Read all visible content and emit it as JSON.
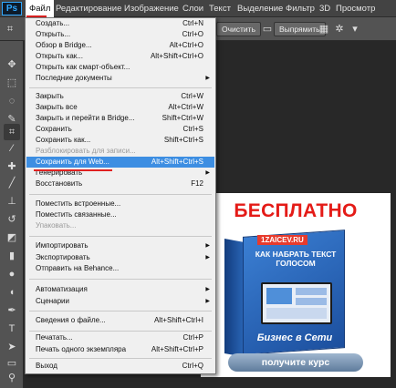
{
  "menubar": {
    "logo": "Ps",
    "items": [
      "Файл",
      "Редактирование",
      "Изображение",
      "Слои",
      "Текст",
      "Выделение",
      "Фильтр",
      "3D",
      "Просмотр"
    ]
  },
  "options": {
    "clear": "Очистить",
    "straighten": "Выпрямить"
  },
  "file_menu": [
    {
      "label": "Создать...",
      "shortcut": "Ctrl+N"
    },
    {
      "label": "Открыть...",
      "shortcut": "Ctrl+O"
    },
    {
      "label": "Обзор в Bridge...",
      "shortcut": "Alt+Ctrl+O"
    },
    {
      "label": "Открыть как...",
      "shortcut": "Alt+Shift+Ctrl+O"
    },
    {
      "label": "Открыть как смарт-объект...",
      "shortcut": ""
    },
    {
      "label": "Последние документы",
      "shortcut": "",
      "submenu": true
    },
    {
      "label": "Закрыть",
      "shortcut": "Ctrl+W"
    },
    {
      "label": "Закрыть все",
      "shortcut": "Alt+Ctrl+W"
    },
    {
      "label": "Закрыть и перейти в Bridge...",
      "shortcut": "Shift+Ctrl+W"
    },
    {
      "label": "Сохранить",
      "shortcut": "Ctrl+S"
    },
    {
      "label": "Сохранить как...",
      "shortcut": "Shift+Ctrl+S"
    },
    {
      "label": "Разблокировать для записи...",
      "shortcut": "",
      "disabled": true
    },
    {
      "label": "Сохранить для Web...",
      "shortcut": "Alt+Shift+Ctrl+S",
      "highlighted": true
    },
    {
      "label": "Генерировать",
      "shortcut": "",
      "submenu": true
    },
    {
      "label": "Восстановить",
      "shortcut": "F12"
    },
    {
      "label": "Поместить встроенные...",
      "shortcut": ""
    },
    {
      "label": "Поместить связанные...",
      "shortcut": ""
    },
    {
      "label": "Упаковать...",
      "shortcut": "",
      "disabled": true
    },
    {
      "label": "Импортировать",
      "shortcut": "",
      "submenu": true
    },
    {
      "label": "Экспортировать",
      "shortcut": "",
      "submenu": true
    },
    {
      "label": "Отправить на Behance...",
      "shortcut": ""
    },
    {
      "label": "Автоматизация",
      "shortcut": "",
      "submenu": true
    },
    {
      "label": "Сценарии",
      "shortcut": "",
      "submenu": true
    },
    {
      "label": "Сведения о файле...",
      "shortcut": "Alt+Shift+Ctrl+I"
    },
    {
      "label": "Печатать...",
      "shortcut": "Ctrl+P"
    },
    {
      "label": "Печать одного экземпляра",
      "shortcut": "Alt+Shift+Ctrl+P"
    },
    {
      "label": "Выход",
      "shortcut": "Ctrl+Q"
    }
  ],
  "ad": {
    "title": "БЕСПЛАТНО",
    "site": "1ZAICEV.RU",
    "subtitle": "КАК НАБРАТЬ ТЕКСТ ГОЛОСОМ",
    "business": "Бизнес в Сети",
    "button": "получите курс"
  },
  "colors": {
    "highlight": "#3d8ee2",
    "accent_red": "#e02020",
    "ad_red": "#e41b17"
  }
}
